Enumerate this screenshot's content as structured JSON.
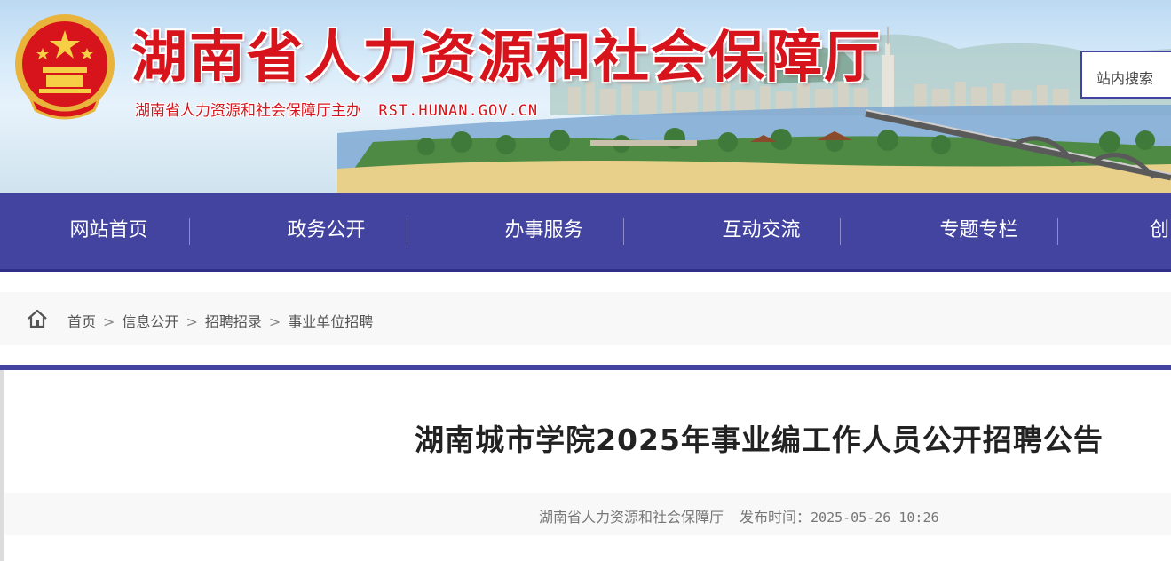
{
  "header": {
    "site_title": "湖南省人力资源和社会保障厅",
    "site_sub_org": "湖南省人力资源和社会保障厅主办",
    "site_sub_domain": "RST.HUNAN.GOV.CN",
    "search_label": "站内搜索",
    "brand_color": "#d7141b"
  },
  "nav": {
    "color": "#4343a0",
    "items": [
      {
        "label": "网站首页"
      },
      {
        "label": "政务公开"
      },
      {
        "label": "办事服务"
      },
      {
        "label": "互动交流"
      },
      {
        "label": "专题专栏"
      },
      {
        "label": "创"
      }
    ]
  },
  "breadcrumb": {
    "icon": "home-icon",
    "separator": ">",
    "items": [
      {
        "label": "首页"
      },
      {
        "label": "信息公开"
      },
      {
        "label": "招聘招录"
      },
      {
        "label": "事业单位招聘"
      }
    ]
  },
  "article": {
    "title": "湖南城市学院2025年事业编工作人员公开招聘公告",
    "source": "湖南省人力资源和社会保障厅",
    "time_label": "发布时间：",
    "time": "2025-05-26 10:26"
  }
}
